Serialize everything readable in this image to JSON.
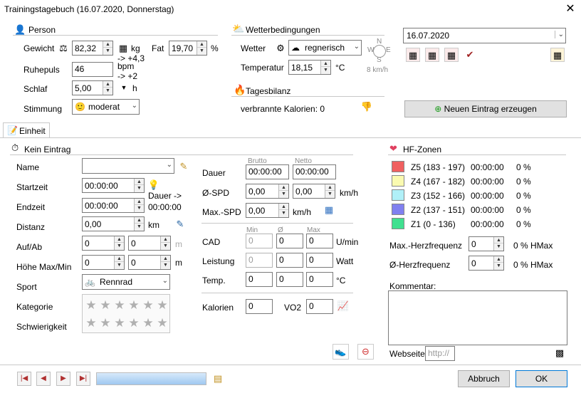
{
  "window": {
    "title": "Trainingstagebuch (16.07.2020, Donnerstag)",
    "close": "✕"
  },
  "person": {
    "header": "Person",
    "gewicht_label": "Gewicht",
    "gewicht_value": "82,32",
    "gewicht_unit": "kg",
    "gewicht_trend": "-> +4,3",
    "fat_label": "Fat",
    "fat_value": "19,70",
    "fat_unit": "%",
    "ruhepuls_label": "Ruhepuls",
    "ruhepuls_value": "46",
    "ruhepuls_unit": "bpm",
    "ruhepuls_trend": "-> +2",
    "schlaf_label": "Schlaf",
    "schlaf_value": "5,00",
    "schlaf_unit": "h",
    "stimmung_label": "Stimmung",
    "stimmung_value": "moderat"
  },
  "wetter": {
    "header": "Wetterbedingungen",
    "wetter_label": "Wetter",
    "wetter_value": "regnerisch",
    "temp_label": "Temperatur",
    "temp_value": "18,15",
    "temp_unit": "°C",
    "wind": "8 km/h",
    "compass": {
      "n": "N",
      "s": "S",
      "w": "W",
      "e": "E"
    }
  },
  "tagesbilanz": {
    "header": "Tagesbilanz",
    "text": "verbrannte Kalorien: 0"
  },
  "date": {
    "value": "16.07.2020"
  },
  "neuer_eintrag": "Neuen Eintrag erzeugen",
  "tab": {
    "label": "Einheit"
  },
  "einheit": {
    "header": "Kein Eintrag",
    "name_label": "Name",
    "name_value": "",
    "startzeit_label": "Startzeit",
    "startzeit_value": "00:00:00",
    "endzeit_label": "Endzeit",
    "endzeit_value": "00:00:00",
    "dauer_hint_1": "Dauer ->",
    "dauer_hint_2": "00:00:00",
    "distanz_label": "Distanz",
    "distanz_value": "0,00",
    "distanz_unit": "km",
    "aufab_label": "Auf/Ab",
    "aufab_1": "0",
    "aufab_2": "0",
    "aufab_unit": "m",
    "hoehe_label": "Höhe Max/Min",
    "hoehe_1": "0",
    "hoehe_2": "0",
    "hoehe_unit": "m",
    "sport_label": "Sport",
    "sport_value": "Rennrad",
    "kategorie_label": "Kategorie",
    "schwierigkeit_label": "Schwierigkeit",
    "star": "★"
  },
  "metrics": {
    "brutto": "Brutto",
    "netto": "Netto",
    "dauer_label": "Dauer",
    "dauer_brutto": "00:00:00",
    "dauer_netto": "00:00:00",
    "spd_label": "Ø-SPD",
    "spd_1": "0,00",
    "spd_2": "0,00",
    "spd_unit": "km/h",
    "maxspd_label": "Max.-SPD",
    "maxspd_value": "0,00",
    "maxspd_unit": "km/h",
    "min": "Min",
    "avg": "Ø",
    "max": "Max",
    "cad_label": "CAD",
    "cad_min": "0",
    "cad_avg": "0",
    "cad_max": "0",
    "cad_unit": "U/min",
    "leistung_label": "Leistung",
    "leistung_min": "0",
    "leistung_avg": "0",
    "leistung_max": "0",
    "leistung_unit": "Watt",
    "temp_label": "Temp.",
    "temp_min": "0",
    "temp_avg": "0",
    "temp_max": "0",
    "temp_unit": "°C",
    "kalorien_label": "Kalorien",
    "kalorien_value": "0",
    "vo2_label": "VO2",
    "vo2_value": "0"
  },
  "hf": {
    "header": "HF-Zonen",
    "zones": [
      {
        "label": "Z5 (183 - 197)",
        "time": "00:00:00",
        "pct": "0 %",
        "color": "#f06060"
      },
      {
        "label": "Z4 (167 - 182)",
        "time": "00:00:00",
        "pct": "0 %",
        "color": "#fafab0"
      },
      {
        "label": "Z3 (152 - 166)",
        "time": "00:00:00",
        "pct": "0 %",
        "color": "#b0f0f8"
      },
      {
        "label": "Z2 (137 - 151)",
        "time": "00:00:00",
        "pct": "0 %",
        "color": "#8080f0"
      },
      {
        "label": "Z1 (0 - 136)",
        "time": "00:00:00",
        "pct": "0 %",
        "color": "#40e090"
      }
    ],
    "maxhf_label": "Max.-Herzfrequenz",
    "maxhf_value": "0",
    "maxhf_pct": "0 % HMax",
    "avghf_label": "Ø-Herzfrequenz",
    "avghf_value": "0",
    "avghf_pct": "0 % HMax",
    "kommentar_label": "Kommentar:",
    "webseite_label": "Webseite:",
    "webseite_placeholder": "http://"
  },
  "buttons": {
    "abbruch": "Abbruch",
    "ok": "OK"
  },
  "nav": {
    "first": "|◀",
    "prev": "◀",
    "next": "▶",
    "last": "▶|"
  }
}
